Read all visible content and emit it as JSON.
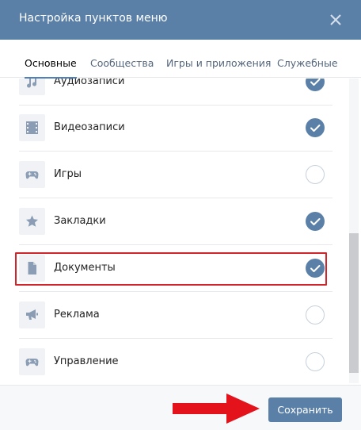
{
  "dialog": {
    "title": "Настройка пунктов меню",
    "close_icon": "close-icon"
  },
  "tabs": [
    {
      "label": "Основные",
      "active": true
    },
    {
      "label": "Сообщества",
      "active": false
    },
    {
      "label": "Игры и приложения",
      "active": false
    },
    {
      "label": "Служебные",
      "active": false
    }
  ],
  "items": [
    {
      "label": "Аудиозаписи",
      "icon": "music-note-icon",
      "checked": true
    },
    {
      "label": "Видеозаписи",
      "icon": "film-icon",
      "checked": true
    },
    {
      "label": "Игры",
      "icon": "gamepad-icon",
      "checked": false
    },
    {
      "label": "Закладки",
      "icon": "star-icon",
      "checked": true
    },
    {
      "label": "Документы",
      "icon": "document-icon",
      "checked": true,
      "highlighted": true
    },
    {
      "label": "Реклама",
      "icon": "megaphone-icon",
      "checked": false
    },
    {
      "label": "Управление",
      "icon": "gamepad-icon",
      "checked": false
    }
  ],
  "footer": {
    "save_label": "Сохранить"
  },
  "colors": {
    "header": "#5b80a8",
    "accent": "#5b80a8",
    "highlight_border": "#d0262b",
    "arrow": "#e3121b"
  }
}
